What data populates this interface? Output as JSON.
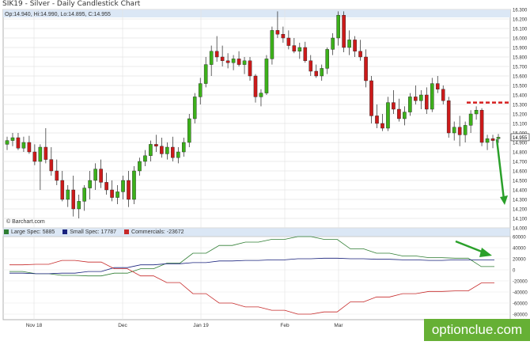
{
  "header": {
    "title": "SIK19 - Silver - Daily Candlestick Chart",
    "ohlc": "Op:14.940, Hi:14.990, Lo:14.895, C:14.955"
  },
  "watermark": "© Barchart.com",
  "last_price_label": "14.955",
  "indicator_legend": [
    {
      "label": "Large Spec: 5885",
      "color": "#2e7d32"
    },
    {
      "label": "Small Spec: 17787",
      "color": "#1a237e"
    },
    {
      "label": "Commercials: -23672",
      "color": "#c62828"
    }
  ],
  "logo": "optionclue.com",
  "colors": {
    "up": "#3cb01a",
    "down": "#cc1a1a",
    "annotation_green": "#2aa02a",
    "annotation_red": "#d62020"
  },
  "chart_data": [
    {
      "type": "candlestick",
      "title": "SIK19 - Silver - Daily Candlestick Chart",
      "ylim": [
        14.0,
        16.3
      ],
      "y_ticks": [
        "16.300",
        "16.200",
        "16.100",
        "16.000",
        "15.900",
        "15.800",
        "15.700",
        "15.600",
        "15.500",
        "15.400",
        "15.300",
        "15.200",
        "15.100",
        "15.000",
        "14.900",
        "14.800",
        "14.700",
        "14.600",
        "14.500",
        "14.400",
        "14.300",
        "14.200",
        "14.100",
        "14.000"
      ],
      "x_ticks": [
        "Nov 18",
        "Dec",
        "Jan 19",
        "Feb",
        "Mar"
      ],
      "grid": true,
      "ohlc_last": {
        "open": 14.94,
        "high": 14.99,
        "low": 14.895,
        "close": 14.955
      },
      "candles": [
        [
          14.88,
          14.96,
          14.82,
          14.92
        ],
        [
          14.92,
          15.0,
          14.86,
          14.95
        ],
        [
          14.95,
          15.0,
          14.82,
          14.84
        ],
        [
          14.84,
          14.96,
          14.8,
          14.9
        ],
        [
          14.9,
          14.97,
          14.78,
          14.8
        ],
        [
          14.8,
          14.88,
          14.66,
          14.7
        ],
        [
          14.7,
          14.88,
          14.4,
          14.85
        ],
        [
          14.85,
          15.05,
          14.68,
          14.72
        ],
        [
          14.72,
          14.85,
          14.55,
          14.6
        ],
        [
          14.6,
          14.72,
          14.45,
          14.5
        ],
        [
          14.5,
          14.6,
          14.28,
          14.3
        ],
        [
          14.3,
          14.45,
          14.22,
          14.4
        ],
        [
          14.4,
          14.55,
          14.12,
          14.2
        ],
        [
          14.2,
          14.35,
          14.1,
          14.28
        ],
        [
          14.28,
          14.45,
          14.18,
          14.42
        ],
        [
          14.42,
          14.6,
          14.3,
          14.5
        ],
        [
          14.5,
          14.68,
          14.4,
          14.62
        ],
        [
          14.62,
          14.72,
          14.42,
          14.48
        ],
        [
          14.48,
          14.58,
          14.35,
          14.4
        ],
        [
          14.4,
          14.5,
          14.28,
          14.32
        ],
        [
          14.32,
          14.45,
          14.25,
          14.38
        ],
        [
          14.38,
          14.55,
          14.3,
          14.5
        ],
        [
          14.5,
          14.6,
          14.22,
          14.3
        ],
        [
          14.3,
          14.65,
          14.25,
          14.6
        ],
        [
          14.6,
          14.74,
          14.55,
          14.7
        ],
        [
          14.7,
          14.82,
          14.65,
          14.76
        ],
        [
          14.76,
          14.92,
          14.7,
          14.88
        ],
        [
          14.88,
          14.98,
          14.8,
          14.86
        ],
        [
          14.86,
          14.95,
          14.74,
          14.78
        ],
        [
          14.78,
          14.9,
          14.72,
          14.85
        ],
        [
          14.85,
          14.96,
          14.7,
          14.74
        ],
        [
          14.74,
          14.85,
          14.68,
          14.8
        ],
        [
          14.8,
          14.95,
          14.75,
          14.9
        ],
        [
          14.9,
          15.2,
          14.85,
          15.15
        ],
        [
          15.15,
          15.42,
          15.1,
          15.38
        ],
        [
          15.38,
          15.58,
          15.3,
          15.52
        ],
        [
          15.52,
          15.8,
          15.48,
          15.72
        ],
        [
          15.72,
          15.92,
          15.6,
          15.86
        ],
        [
          15.86,
          16.02,
          15.75,
          15.8
        ],
        [
          15.8,
          15.92,
          15.7,
          15.76
        ],
        [
          15.76,
          15.84,
          15.68,
          15.74
        ],
        [
          15.74,
          15.82,
          15.66,
          15.78
        ],
        [
          15.78,
          15.86,
          15.7,
          15.72
        ],
        [
          15.72,
          15.8,
          15.62,
          15.76
        ],
        [
          15.76,
          15.8,
          15.55,
          15.6
        ],
        [
          15.6,
          15.62,
          15.32,
          15.38
        ],
        [
          15.38,
          15.46,
          15.28,
          15.42
        ],
        [
          15.42,
          15.82,
          15.4,
          15.78
        ],
        [
          15.78,
          16.12,
          15.72,
          16.08
        ],
        [
          16.08,
          16.28,
          16.0,
          16.04
        ],
        [
          16.04,
          16.12,
          15.95,
          16.0
        ],
        [
          16.0,
          16.08,
          15.88,
          15.92
        ],
        [
          15.92,
          16.0,
          15.84,
          15.86
        ],
        [
          15.86,
          15.95,
          15.78,
          15.9
        ],
        [
          15.9,
          15.96,
          15.74,
          15.76
        ],
        [
          15.76,
          15.82,
          15.6,
          15.65
        ],
        [
          15.65,
          15.72,
          15.58,
          15.6
        ],
        [
          15.6,
          15.72,
          15.55,
          15.68
        ],
        [
          15.68,
          15.9,
          15.62,
          15.88
        ],
        [
          15.88,
          16.05,
          15.82,
          16.0
        ],
        [
          16.0,
          16.28,
          15.92,
          16.24
        ],
        [
          16.24,
          16.28,
          15.85,
          15.9
        ],
        [
          15.9,
          16.08,
          15.82,
          15.98
        ],
        [
          15.98,
          16.02,
          15.8,
          15.86
        ],
        [
          15.86,
          15.98,
          15.76,
          15.8
        ],
        [
          15.8,
          15.88,
          15.48,
          15.55
        ],
        [
          15.55,
          15.6,
          15.1,
          15.18
        ],
        [
          15.18,
          15.3,
          15.05,
          15.1
        ],
        [
          15.1,
          15.2,
          15.02,
          15.05
        ],
        [
          15.05,
          15.38,
          15.02,
          15.32
        ],
        [
          15.32,
          15.45,
          15.2,
          15.25
        ],
        [
          15.25,
          15.36,
          15.12,
          15.15
        ],
        [
          15.15,
          15.28,
          15.08,
          15.22
        ],
        [
          15.22,
          15.42,
          15.18,
          15.38
        ],
        [
          15.38,
          15.5,
          15.3,
          15.34
        ],
        [
          15.34,
          15.45,
          15.25,
          15.4
        ],
        [
          15.4,
          15.48,
          15.2,
          15.25
        ],
        [
          15.25,
          15.58,
          15.22,
          15.52
        ],
        [
          15.52,
          15.6,
          15.42,
          15.46
        ],
        [
          15.46,
          15.5,
          15.3,
          15.34
        ],
        [
          15.34,
          15.38,
          14.95,
          15.0
        ],
        [
          15.0,
          15.12,
          14.92,
          15.06
        ],
        [
          15.06,
          15.18,
          14.86,
          14.98
        ],
        [
          14.98,
          15.12,
          14.9,
          15.08
        ],
        [
          15.08,
          15.24,
          15.0,
          15.2
        ],
        [
          15.2,
          15.28,
          15.14,
          15.24
        ],
        [
          15.24,
          15.26,
          14.86,
          14.9
        ],
        [
          14.9,
          14.98,
          14.82,
          14.94
        ],
        [
          14.94,
          14.98,
          14.84,
          14.92
        ],
        [
          14.94,
          14.99,
          14.895,
          14.955
        ]
      ],
      "annotations": {
        "resistance_level": 15.32,
        "trend_arrow": "down"
      }
    },
    {
      "type": "line",
      "title": "Commitment of Traders",
      "ylim": [
        -90000,
        60000
      ],
      "y_ticks": [
        "60000",
        "40000",
        "20000",
        "0",
        "-20000",
        "-40000",
        "-60000",
        "-80000"
      ],
      "series": [
        {
          "name": "Large Spec",
          "values": [
            -3000,
            -3000,
            -7000,
            -7000,
            -10000,
            -10000,
            -11000,
            -11000,
            -6000,
            -6000,
            2000,
            2000,
            12000,
            12000,
            30000,
            30000,
            44000,
            44000,
            50000,
            50000,
            55000,
            55000,
            60000,
            60000,
            55000,
            55000,
            38000,
            38000,
            30000,
            30000,
            25000,
            25000,
            22000,
            22000,
            21000,
            21000,
            5885,
            5885
          ]
        },
        {
          "name": "Small Spec",
          "values": [
            -6000,
            -6000,
            -7000,
            -7000,
            -6000,
            -6000,
            -3000,
            -3000,
            4000,
            4000,
            9000,
            9000,
            11000,
            11000,
            13000,
            13000,
            16000,
            16000,
            17000,
            17000,
            18000,
            18000,
            20000,
            20000,
            21000,
            21000,
            20000,
            20000,
            19000,
            19000,
            18000,
            18000,
            17000,
            17000,
            18000,
            18000,
            17787,
            17787
          ]
        },
        {
          "name": "Commercials",
          "values": [
            9000,
            9000,
            10000,
            10000,
            17000,
            17000,
            14000,
            14000,
            2000,
            2000,
            -11000,
            -11000,
            -23000,
            -23000,
            -43000,
            -43000,
            -60000,
            -60000,
            -67000,
            -67000,
            -73000,
            -73000,
            -80000,
            -80000,
            -76000,
            -76000,
            -58000,
            -58000,
            -49000,
            -49000,
            -43000,
            -43000,
            -39000,
            -39000,
            -38000,
            -38000,
            -23672,
            -23672
          ]
        }
      ]
    }
  ]
}
